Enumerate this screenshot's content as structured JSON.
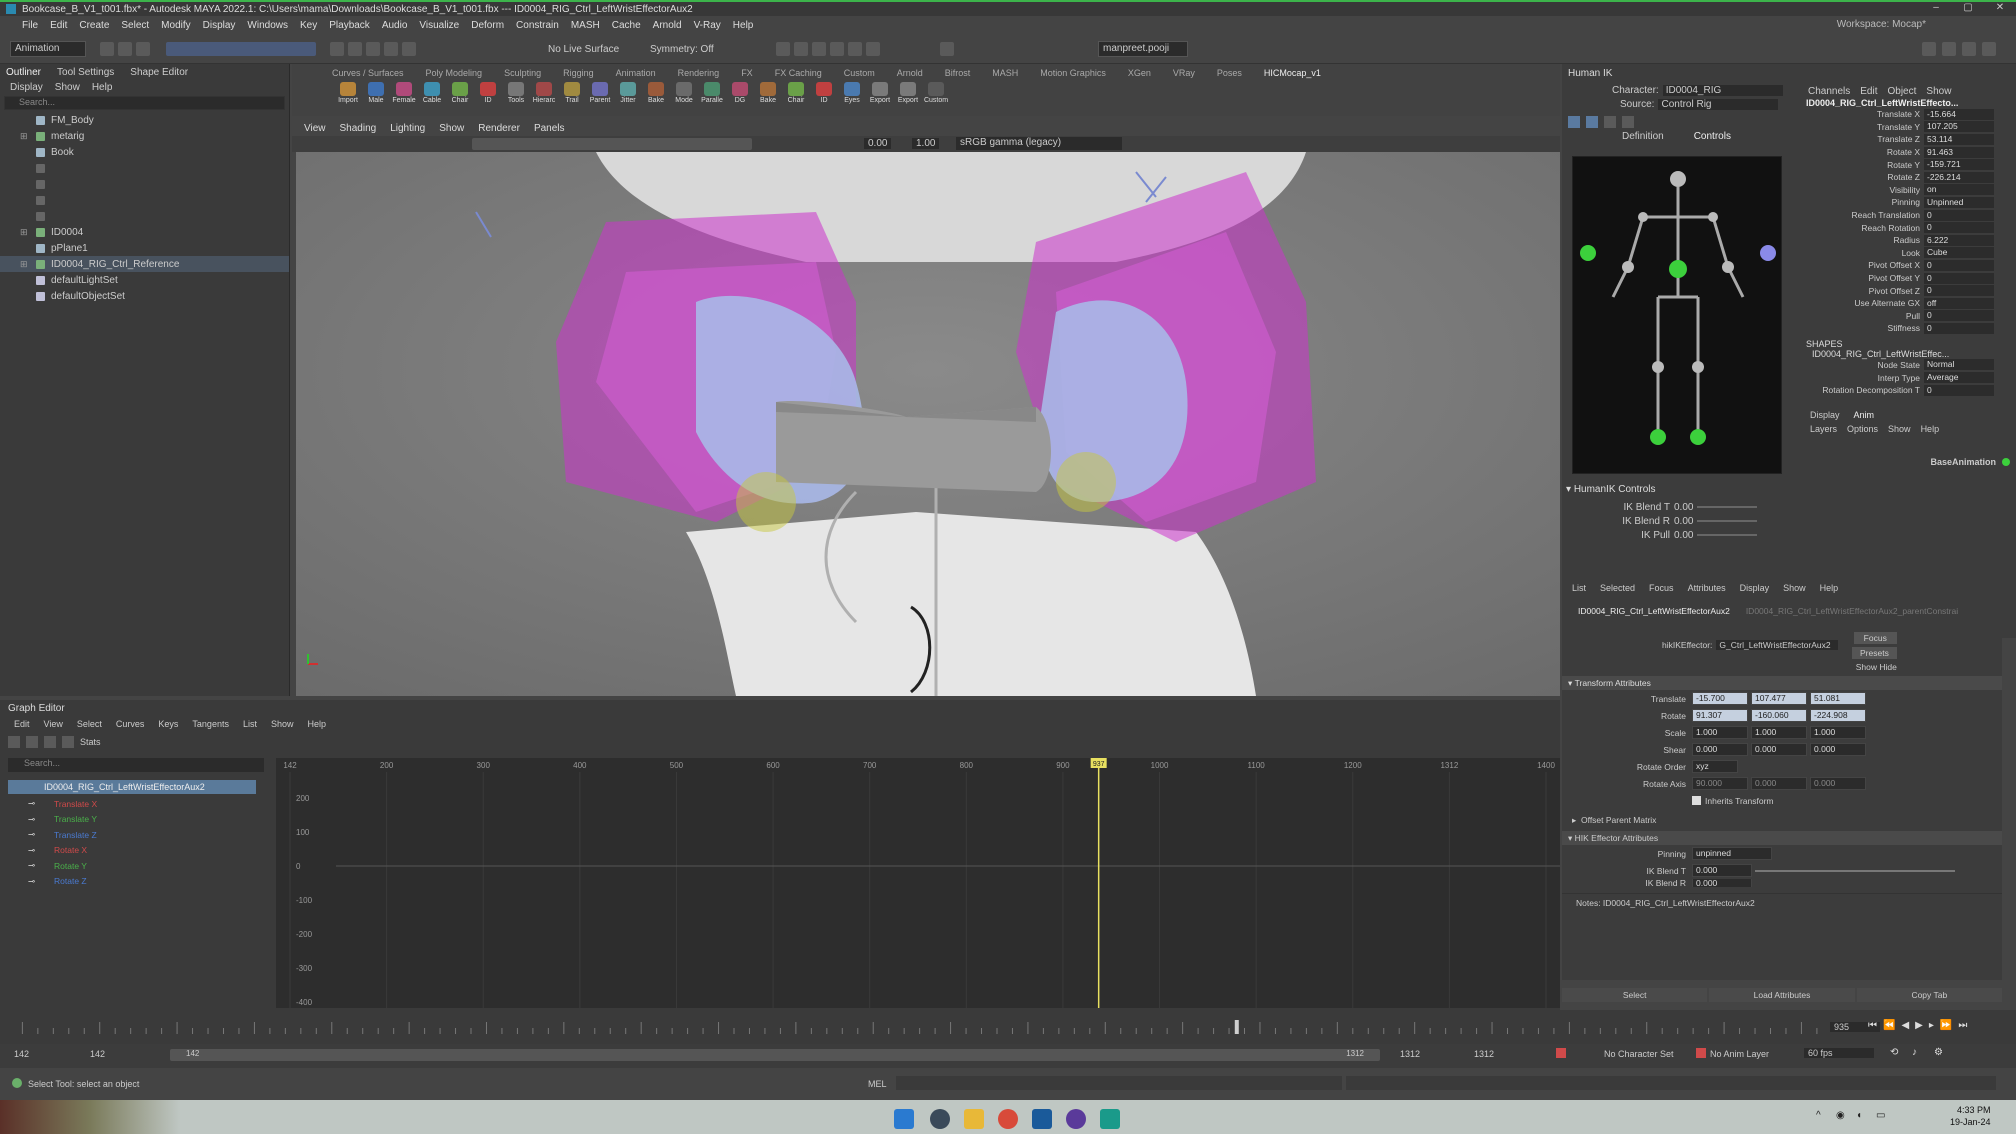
{
  "window": {
    "title": "Bookcase_B_V1_t001.fbx* - Autodesk MAYA 2022.1: C:\\Users\\mama\\Downloads\\Bookcase_B_V1_t001.fbx --- ID0004_RIG_Ctrl_LeftWristEffectorAux2"
  },
  "menu": [
    "File",
    "Edit",
    "Create",
    "Select",
    "Modify",
    "Display",
    "Windows",
    "Key",
    "Playback",
    "Audio",
    "Visualize",
    "Deform",
    "Constrain",
    "MASH",
    "Cache",
    "Arnold",
    "V-Ray",
    "Help"
  ],
  "workspace": "Workspace: Mocap*",
  "toolbar": {
    "menuset": "Animation",
    "live_surface": "No Live Surface",
    "symmetry": "Symmetry: Off",
    "user": "manpreet.pooji"
  },
  "outliner": {
    "tabs": [
      "Outliner",
      "Tool Settings",
      "Shape Editor"
    ],
    "menu": [
      "Display",
      "Show",
      "Help"
    ],
    "search": "Search...",
    "items": [
      "FM_Body",
      "metarig",
      "Book",
      "",
      "",
      "",
      "",
      "ID0004",
      "pPlane1",
      "ID0004_RIG_Ctrl_Reference",
      "defaultLightSet",
      "defaultObjectSet"
    ]
  },
  "shelf": {
    "tabs": [
      "Curves / Surfaces",
      "Poly Modeling",
      "Sculpting",
      "Rigging",
      "Animation",
      "Rendering",
      "FX",
      "FX Caching",
      "Custom",
      "Arnold",
      "Bifrost",
      "MASH",
      "Motion Graphics",
      "XGen",
      "VRay",
      "Poses",
      "HICMocap_v1"
    ],
    "icons": [
      {
        "label": "Import",
        "color": "#b7843a"
      },
      {
        "label": "Male",
        "color": "#3e6fb0"
      },
      {
        "label": "Female",
        "color": "#b04a7a"
      },
      {
        "label": "Cable",
        "color": "#3e8fb0"
      },
      {
        "label": "Chair",
        "color": "#6aa048"
      },
      {
        "label": "ID",
        "color": "#c04040"
      },
      {
        "label": "Tools",
        "color": "#777"
      },
      {
        "label": "Hierarc",
        "color": "#a04848"
      },
      {
        "label": "Trail",
        "color": "#a08a40"
      },
      {
        "label": "Parent",
        "color": "#6a6ab0"
      },
      {
        "label": "Jitter",
        "color": "#5a9a9a"
      },
      {
        "label": "Bake",
        "color": "#9a5a3a"
      },
      {
        "label": "Mode",
        "color": "#6a6a6a"
      },
      {
        "label": "Paralle",
        "color": "#4a8a6a"
      },
      {
        "label": "DG",
        "color": "#aa4a6a"
      },
      {
        "label": "Bake",
        "color": "#a06a3a"
      },
      {
        "label": "Chair",
        "color": "#6aa048"
      },
      {
        "label": "ID",
        "color": "#c04040"
      },
      {
        "label": "Eyes",
        "color": "#4a7ab0"
      },
      {
        "label": "Export",
        "color": "#7a7a7a"
      },
      {
        "label": "Export",
        "color": "#7a7a7a"
      },
      {
        "label": "Custom",
        "color": "#5a5a5a"
      }
    ]
  },
  "viewport": {
    "menu": [
      "View",
      "Shading",
      "Lighting",
      "Show",
      "Renderer",
      "Panels"
    ],
    "near": "0.00",
    "far": "1.00",
    "colorspace": "sRGB gamma (legacy)"
  },
  "hik": {
    "title": "Human IK",
    "character_label": "Character:",
    "character": "ID0004_RIG",
    "source_label": "Source:",
    "source": "Control Rig",
    "tabs": [
      "Definition",
      "Controls"
    ],
    "controls_title": "HumanIK Controls",
    "sliders": [
      {
        "label": "IK Blend T",
        "value": "0.00"
      },
      {
        "label": "IK Blend R",
        "value": "0.00"
      },
      {
        "label": "IK Pull",
        "value": "0.00"
      }
    ]
  },
  "channels": {
    "menu": [
      "Channels",
      "Edit",
      "Object",
      "Show"
    ],
    "node": "ID0004_RIG_Ctrl_LeftWristEffecto...",
    "rows": [
      {
        "n": "Translate X",
        "v": "-15.664"
      },
      {
        "n": "Translate Y",
        "v": "107.205"
      },
      {
        "n": "Translate Z",
        "v": "53.114"
      },
      {
        "n": "Rotate X",
        "v": "91.463"
      },
      {
        "n": "Rotate Y",
        "v": "-159.721"
      },
      {
        "n": "Rotate Z",
        "v": "-226.214"
      },
      {
        "n": "Visibility",
        "v": "on"
      },
      {
        "n": "Pinning",
        "v": "Unpinned"
      },
      {
        "n": "Reach Translation",
        "v": "0"
      },
      {
        "n": "Reach Rotation",
        "v": "0"
      },
      {
        "n": "Radius",
        "v": "6.222"
      },
      {
        "n": "Look",
        "v": "Cube"
      },
      {
        "n": "Pivot Offset X",
        "v": "0"
      },
      {
        "n": "Pivot Offset Y",
        "v": "0"
      },
      {
        "n": "Pivot Offset Z",
        "v": "0"
      },
      {
        "n": "Use Alternate GX",
        "v": "off"
      },
      {
        "n": "Pull",
        "v": "0"
      },
      {
        "n": "Stiffness",
        "v": "0"
      }
    ],
    "shapes_title": "SHAPES",
    "shapes_node": "ID0004_RIG_Ctrl_LeftWristEffec...",
    "shape_rows": [
      {
        "n": "Node State",
        "v": "Normal"
      },
      {
        "n": "Interp Type",
        "v": "Average"
      },
      {
        "n": "Rotation Decomposition T",
        "v": "0"
      }
    ],
    "layer_tabs": [
      "Display",
      "Anim"
    ],
    "layer_menu": [
      "Layers",
      "Options",
      "Show",
      "Help"
    ],
    "base_layer": "BaseAnimation"
  },
  "attr_editor": {
    "menu": [
      "List",
      "Selected",
      "Focus",
      "Attributes",
      "Display",
      "Show",
      "Help"
    ],
    "tab1": "ID0004_RIG_Ctrl_LeftWristEffectorAux2",
    "tab2": "ID0004_RIG_Ctrl_LeftWristEffectorAux2_parentConstrai",
    "node_label": "hikIKEffector:",
    "node_value": "G_Ctrl_LeftWristEffectorAux2",
    "buttons": [
      "Focus",
      "Presets",
      "Show",
      "Hide"
    ],
    "section_transform": "Transform Attributes",
    "translate": {
      "label": "Translate",
      "x": "-15.700",
      "y": "107.477",
      "z": "51.081"
    },
    "rotate": {
      "label": "Rotate",
      "x": "91.307",
      "y": "-160.060",
      "z": "-224.908"
    },
    "scale": {
      "label": "Scale",
      "x": "1.000",
      "y": "1.000",
      "z": "1.000"
    },
    "shear": {
      "label": "Shear",
      "x": "0.000",
      "y": "0.000",
      "z": "0.000"
    },
    "rotate_order": {
      "label": "Rotate Order",
      "value": "xyz"
    },
    "rotate_axis": {
      "label": "Rotate Axis",
      "x": "90.000",
      "y": "0.000",
      "z": "0.000"
    },
    "inherits": "Inherits Transform",
    "section_offset": "Offset Parent Matrix",
    "section_hik": "HIK Effector Attributes",
    "pinning": {
      "label": "Pinning",
      "value": "unpinned"
    },
    "ikblend_t": {
      "label": "IK Blend T",
      "value": "0.000"
    },
    "ikblend_r": {
      "label": "IK Blend R",
      "value": "0.000"
    },
    "notes": "Notes: ID0004_RIG_Ctrl_LeftWristEffectorAux2",
    "bottom_buttons": [
      "Select",
      "Load Attributes",
      "Copy Tab"
    ]
  },
  "graph": {
    "title": "Graph Editor",
    "menu": [
      "Edit",
      "View",
      "Select",
      "Curves",
      "Keys",
      "Tangents",
      "List",
      "Show",
      "Help"
    ],
    "stats": "Stats",
    "search": "Search...",
    "node": "ID0004_RIG_Ctrl_LeftWristEffectorAux2",
    "curves": [
      {
        "name": "Translate X",
        "color": "#d04a4a"
      },
      {
        "name": "Translate Y",
        "color": "#4ab04a"
      },
      {
        "name": "Translate Z",
        "color": "#4a7ad0"
      },
      {
        "name": "Rotate X",
        "color": "#d04a4a"
      },
      {
        "name": "Rotate Y",
        "color": "#4ab04a"
      },
      {
        "name": "Rotate Z",
        "color": "#4a7ad0"
      }
    ],
    "x_ticks": [
      "142",
      "200",
      "300",
      "400",
      "500",
      "600",
      "700",
      "800",
      "900",
      "1000",
      "1100",
      "1200",
      "1312",
      "1400"
    ],
    "y_ticks": [
      "200",
      "100",
      "0",
      "-100",
      "-200",
      "-300",
      "-400"
    ],
    "current_frame": "937"
  },
  "timeline": {
    "start": "142",
    "playback_start": "142",
    "range_label": "142",
    "range_end": "1312",
    "end": "1312",
    "playback_end": "1312",
    "current": "935",
    "character_set": "No Character Set",
    "anim_layer": "No Anim Layer",
    "fps": "60 fps"
  },
  "status": {
    "help": "Select Tool: select an object",
    "mel": "MEL"
  },
  "taskbar": {
    "time": "4:33 PM",
    "date": "19-Jan-24"
  }
}
